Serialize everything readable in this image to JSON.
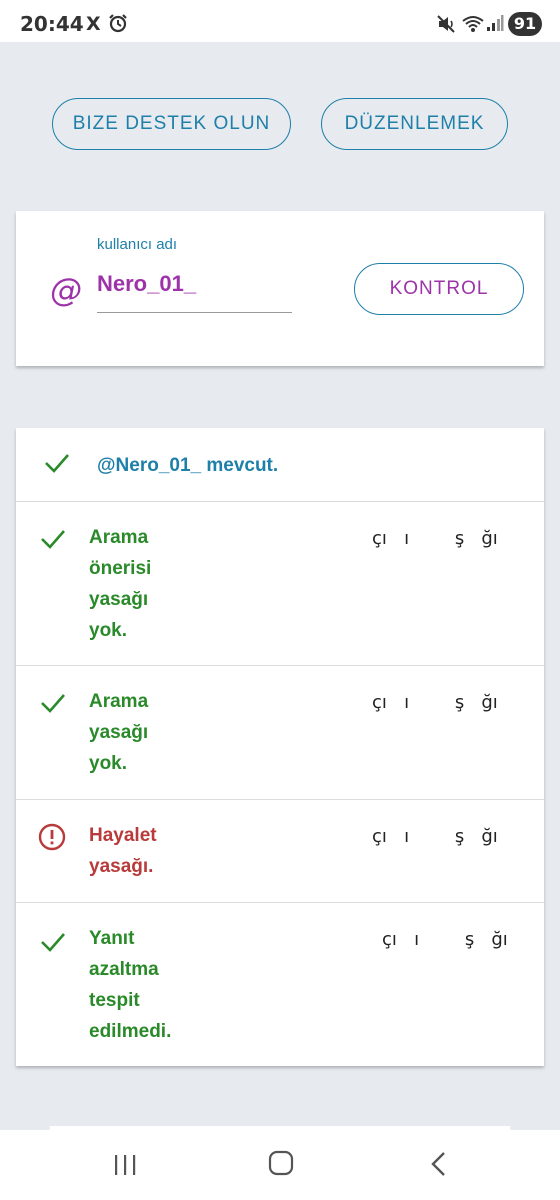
{
  "status_bar": {
    "time": "20:44",
    "x_logo": "X",
    "alarm_icon": "alarm-icon",
    "mute_icon": "mute-icon",
    "wifi_icon": "wifi-icon",
    "signal_icon": "signal-icon",
    "battery": "91"
  },
  "top_buttons": {
    "support_label": "BIZE DESTEK OLUN",
    "edit_label": "DÜZENLEMEK"
  },
  "username_card": {
    "at_symbol": "@",
    "label": "kullanıcı adı",
    "value": "Nero_01_",
    "check_label": "KONTROL"
  },
  "results": {
    "exists": "@Nero_01_ mevcut.",
    "items": [
      {
        "status": "ok",
        "lines": [
          "Arama",
          "önerisi",
          "yasağı",
          "yok."
        ],
        "extra": "çı   ı        ş   ğı"
      },
      {
        "status": "ok",
        "lines": [
          "Arama",
          "yasağı",
          "yok."
        ],
        "extra": "çı   ı        ş   ğı"
      },
      {
        "status": "error",
        "lines": [
          "Hayalet",
          "yasağı."
        ],
        "extra": "çı   ı        ş   ğı"
      },
      {
        "status": "ok",
        "lines": [
          "Yanıt",
          "azaltma",
          "tespit",
          "edilmedi."
        ],
        "extra": "çı   ı        ş   ğı"
      }
    ]
  },
  "colors": {
    "accent_blue": "#1e7fa9",
    "purple": "#9d33a8",
    "success_green": "#2a8a2a",
    "error_red": "#b83a3a",
    "background": "#e7ebef"
  },
  "nav_bar": {
    "recent_icon": "recent-apps-icon",
    "home_icon": "home-icon",
    "back_icon": "back-icon"
  }
}
